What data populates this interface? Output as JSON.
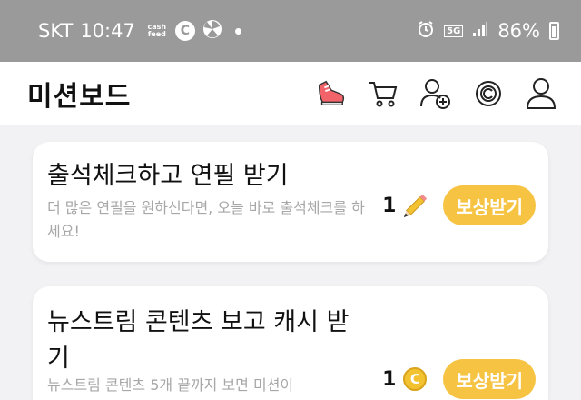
{
  "status_bar": {
    "carrier": "SKT",
    "time": "10:47",
    "cashfeed_label": "cash feed",
    "coin_glyph": "C",
    "network": "5G",
    "battery": "86%"
  },
  "header": {
    "title": "미션보드",
    "icons": [
      "sneaker-icon",
      "cart-icon",
      "add-friend-icon",
      "coin-history-icon",
      "profile-icon"
    ]
  },
  "missions": [
    {
      "title": "출석체크하고 연필 받기",
      "description": "더 많은 연필을 원하신다면, 오늘 바로 출석체크를 하세요!",
      "reward_count": "1",
      "reward_icon": "pencil-icon",
      "button_label": "보상받기"
    },
    {
      "title": "뉴스트림 콘텐츠 보고 캐시 받기",
      "description": "뉴스트림 콘텐츠 5개 끝까지 보면 미션이",
      "reward_count": "1",
      "reward_icon": "coin-icon",
      "coin_glyph": "C",
      "button_label": "보상받기"
    }
  ],
  "colors": {
    "accent": "#f6c343",
    "status_bar_bg": "#9a9a9a",
    "page_bg": "#f2f2f4",
    "desc_text": "#a7a7a7"
  }
}
